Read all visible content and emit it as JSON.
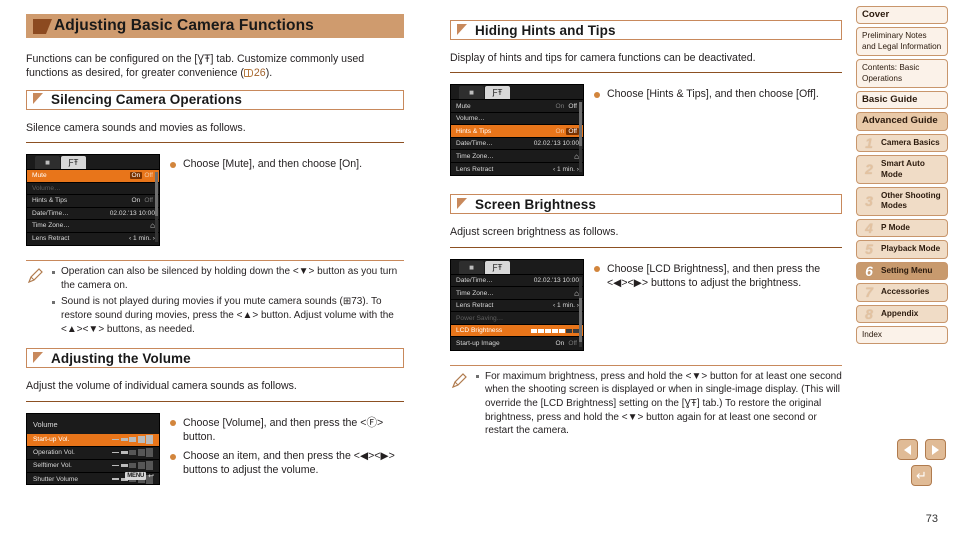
{
  "chapter": {
    "title": "Adjusting Basic Camera Functions"
  },
  "intro": {
    "line1": "Functions can be configured on the [",
    "tab_icon": "ƔŦ",
    "line2": "] tab. Customize commonly used",
    "line3": "functions as desired, for greater convenience (",
    "ref": "26",
    "line4": ")."
  },
  "sections": [
    {
      "id": "silencing",
      "heading": "Silencing Camera Operations",
      "intro": "Silence camera sounds and movies as follows.",
      "bullets": [
        "Choose [Mute], and then choose [On]."
      ]
    },
    {
      "id": "volume",
      "heading": "Adjusting the Volume",
      "intro": "Adjust the volume of individual camera sounds as follows.",
      "bullets": [
        "Choose [Volume], and then press the <Ⓕ> button.",
        "Choose an item, and then press the <◀><▶> buttons to adjust the volume."
      ]
    },
    {
      "id": "hints",
      "heading": "Hiding Hints and Tips",
      "intro": "Display of hints and tips for camera functions can be deactivated.",
      "bullets": [
        "Choose [Hints & Tips], and then choose [Off]."
      ]
    },
    {
      "id": "brightness",
      "heading": "Screen Brightness",
      "intro": "Adjust screen brightness as follows.",
      "bullets": [
        "Choose [LCD Brightness], and then press the <◀><▶> buttons to adjust the brightness."
      ]
    }
  ],
  "notes": {
    "silencing": [
      "Operation can also be silenced by holding down the <▼> button as you turn the camera on.",
      "Sound is not played during movies if you mute camera sounds (⊞73). To restore sound during movies, press the <▲> button. Adjust volume with the <▲><▼> buttons, as needed."
    ],
    "brightness": [
      "For maximum brightness, press and hold the <▼> button for at least one second when the shooting screen is displayed or when in single-image display. (This will override the [LCD Brightness] setting on the [ƔŦ] tab.) To restore the original brightness, press and hold the <▼> button again for at least one second or restart the camera."
    ]
  },
  "lcd_screens": {
    "mute": {
      "tabs": [
        "▣",
        "ƔŦ"
      ],
      "rows": [
        {
          "label": "Mute",
          "on": "On",
          "off": "Off",
          "selected": true,
          "chosen": "on"
        },
        {
          "label": "Volume…",
          "value": "",
          "dim": true
        },
        {
          "label": "Hints & Tips",
          "on": "On",
          "off": "Off",
          "chosen_dim": "off"
        },
        {
          "label": "Date/Time…",
          "value": "02.02.'13 10:00"
        },
        {
          "label": "Time Zone…",
          "value": "⌂"
        },
        {
          "label": "Lens Retract",
          "value": "‹ 1 min. ›"
        }
      ]
    },
    "hints": {
      "rows": [
        {
          "label": "Mute",
          "on": "On",
          "off": "Off",
          "dimfirst": true
        },
        {
          "label": "Volume…",
          "value": ""
        },
        {
          "label": "Hints & Tips",
          "on": "On",
          "off": "Off",
          "selected": true,
          "chosen": "off"
        },
        {
          "label": "Date/Time…",
          "value": "02.02.'13 10:00"
        },
        {
          "label": "Time Zone…",
          "value": "⌂"
        },
        {
          "label": "Lens Retract",
          "value": "‹ 1 min. ›"
        }
      ]
    },
    "brightness": {
      "rows": [
        {
          "label": "Date/Time…",
          "value": "02.02.'13 10:00"
        },
        {
          "label": "Time Zone…",
          "value": "⌂"
        },
        {
          "label": "Lens Retract",
          "value": "‹ 1 min. ›"
        },
        {
          "label": "Power Saving…",
          "value": "",
          "dim": true
        },
        {
          "label": "LCD Brightness",
          "bar": true,
          "selected": true
        },
        {
          "label": "Start-up Image",
          "on": "On",
          "off": "Off"
        }
      ]
    },
    "volume": {
      "title": "Volume",
      "rows": [
        {
          "label": "Start-up Vol.",
          "level": 5,
          "selected": true
        },
        {
          "label": "Operation Vol.",
          "level": 2
        },
        {
          "label": "Selftimer Vol.",
          "level": 2
        },
        {
          "label": "Shutter Volume",
          "level": 2
        }
      ],
      "menu_label": "MENU",
      "return_glyph": "↩"
    }
  },
  "sidebar": {
    "items": [
      {
        "label": "Cover",
        "style": "bold"
      },
      {
        "label": "Preliminary Notes and Legal Information",
        "style": "plain"
      },
      {
        "label": "Contents: Basic Operations",
        "style": "plain"
      },
      {
        "label": "Basic Guide",
        "style": "bold"
      },
      {
        "label": "Advanced Guide",
        "style": "tan"
      },
      {
        "num": "1",
        "label": "Camera Basics",
        "style": "chap"
      },
      {
        "num": "2",
        "label": "Smart Auto Mode",
        "style": "chap"
      },
      {
        "num": "3",
        "label": "Other Shooting Modes",
        "style": "chap"
      },
      {
        "num": "4",
        "label": "P Mode",
        "style": "chap"
      },
      {
        "num": "5",
        "label": "Playback Mode",
        "style": "chap"
      },
      {
        "num": "6",
        "label": "Setting Menu",
        "style": "current"
      },
      {
        "num": "7",
        "label": "Accessories",
        "style": "chap"
      },
      {
        "num": "8",
        "label": "Appendix",
        "style": "chap"
      },
      {
        "label": "Index",
        "style": "plain"
      }
    ]
  },
  "footer": {
    "prev_icon": "prev-page-arrow",
    "next_icon": "next-page-arrow",
    "back_icon": "return-arrow",
    "page_number": "73"
  },
  "colors": {
    "banner": "#cf9b6e",
    "accent": "#c8895c",
    "highlight": "#e8751a",
    "link": "#a0622c"
  }
}
